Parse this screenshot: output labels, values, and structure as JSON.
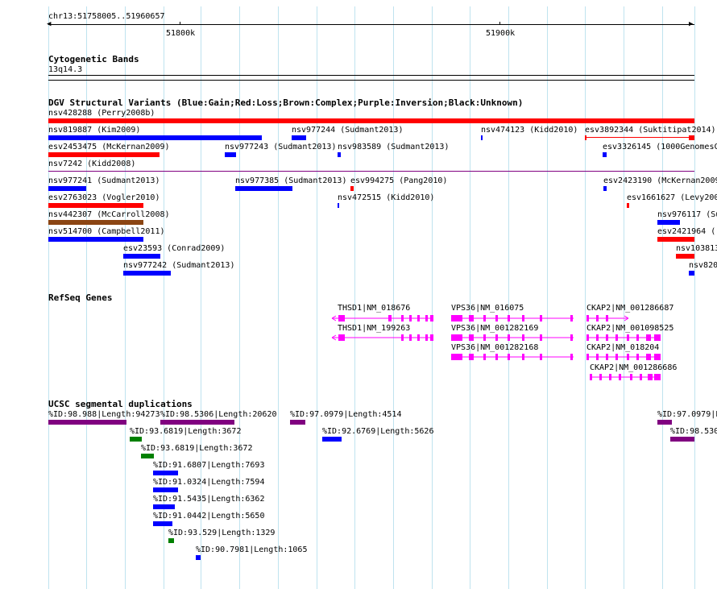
{
  "location": "chr13:51758005..51960657",
  "ruler": {
    "ticks": [
      "51800k",
      "51900k"
    ]
  },
  "colors": {
    "gain": "#0000ff",
    "loss": "#ff0000",
    "complex": "#8b4513",
    "purple": "#800080",
    "green": "#008000",
    "gene": "#ff00ff",
    "grid": "#bfe3ef"
  },
  "tracks": {
    "cytoband": {
      "title": "Cytogenetic Bands",
      "band": "13q14.3"
    },
    "dgv": {
      "title": "DGV Structural Variants (Blue:Gain;Red:Loss;Brown:Complex;Purple:Inversion;Black:Unknown)",
      "features": [
        {
          "id": "nsv428288",
          "label": "nsv428288 (Perry2008b)",
          "type": "loss"
        },
        {
          "id": "nsv819887",
          "label": "nsv819887 (Kim2009)",
          "type": "gain"
        },
        {
          "id": "nsv977244",
          "label": "nsv977244 (Sudmant2013)",
          "type": "gain"
        },
        {
          "id": "nsv474123",
          "label": "nsv474123 (Kidd2010)",
          "type": "gain"
        },
        {
          "id": "esv3892344",
          "label": "esv3892344 (Suktitipat2014)",
          "type": "loss"
        },
        {
          "id": "esv2453475",
          "label": "esv2453475 (McKernan2009)",
          "type": "loss"
        },
        {
          "id": "nsv977243",
          "label": "nsv977243 (Sudmant2013)",
          "type": "gain"
        },
        {
          "id": "nsv983589",
          "label": "nsv983589 (Sudmant2013)",
          "type": "gain"
        },
        {
          "id": "esv3326145",
          "label": "esv3326145 (1000GenomesC",
          "type": "gain"
        },
        {
          "id": "nsv7242",
          "label": "nsv7242 (Kidd2008)",
          "type": "inversion"
        },
        {
          "id": "nsv977241",
          "label": "nsv977241 (Sudmant2013)",
          "type": "gain"
        },
        {
          "id": "nsv977385",
          "label": "nsv977385 (Sudmant2013)",
          "type": "gain"
        },
        {
          "id": "esv994275",
          "label": "esv994275 (Pang2010)",
          "type": "loss"
        },
        {
          "id": "esv2423190",
          "label": "esv2423190 (McKernan2009",
          "type": "gain"
        },
        {
          "id": "esv2763023",
          "label": "esv2763023 (Vogler2010)",
          "type": "loss"
        },
        {
          "id": "nsv472515",
          "label": "nsv472515 (Kidd2010)",
          "type": "gain"
        },
        {
          "id": "esv1661627",
          "label": "esv1661627 (Levy200",
          "type": "loss"
        },
        {
          "id": "nsv442307",
          "label": "nsv442307 (McCarroll2008)",
          "type": "complex"
        },
        {
          "id": "nsv976117",
          "label": "nsv976117 (Su",
          "type": "gain"
        },
        {
          "id": "nsv514700",
          "label": "nsv514700 (Campbell2011)",
          "type": "gain"
        },
        {
          "id": "esv2421964",
          "label": "esv2421964 (",
          "type": "loss"
        },
        {
          "id": "esv23593",
          "label": "esv23593 (Conrad2009)",
          "type": "gain"
        },
        {
          "id": "nsv103813",
          "label": "nsv103813",
          "type": "loss"
        },
        {
          "id": "nsv977242",
          "label": "nsv977242 (Sudmant2013)",
          "type": "gain"
        },
        {
          "id": "nsv820",
          "label": "nsv820",
          "type": "gain"
        }
      ]
    },
    "refseq": {
      "title": "RefSeq Genes",
      "genes": [
        {
          "label": "THSD1|NM_018676",
          "strand": "-"
        },
        {
          "label": "THSD1|NM_199263",
          "strand": "-"
        },
        {
          "label": "VPS36|NM_016075",
          "strand": "-"
        },
        {
          "label": "VPS36|NM_001282169",
          "strand": "-"
        },
        {
          "label": "VPS36|NM_001282168",
          "strand": "-"
        },
        {
          "label": "CKAP2|NM_001286687",
          "strand": "+"
        },
        {
          "label": "CKAP2|NM_001098525",
          "strand": "+"
        },
        {
          "label": "CKAP2|NM_018204",
          "strand": "+"
        },
        {
          "label": "CKAP2|NM_001286686",
          "strand": "+"
        }
      ]
    },
    "segdups": {
      "title": "UCSC segmental duplications",
      "features": [
        {
          "label": "%ID:98.988|Length:94273",
          "color": "purple"
        },
        {
          "label": "%ID:98.5306|Length:20620",
          "color": "purple"
        },
        {
          "label": "%ID:97.0979|Length:4514",
          "color": "purple"
        },
        {
          "label": "%ID:97.0979|L",
          "color": "purple"
        },
        {
          "label": "%ID:93.6819|Length:3672",
          "color": "green"
        },
        {
          "label": "%ID:92.6769|Length:5626",
          "color": "gain"
        },
        {
          "label": "%ID:98.530",
          "color": "purple"
        },
        {
          "label": "%ID:93.6819|Length:3672",
          "color": "green"
        },
        {
          "label": "%ID:91.6807|Length:7693",
          "color": "gain"
        },
        {
          "label": "%ID:91.0324|Length:7594",
          "color": "gain"
        },
        {
          "label": "%ID:91.5435|Length:6362",
          "color": "gain"
        },
        {
          "label": "%ID:91.0442|Length:5650",
          "color": "gain"
        },
        {
          "label": "%ID:93.529|Length:1329",
          "color": "green"
        },
        {
          "label": "%ID:90.7981|Length:1065",
          "color": "gain"
        }
      ]
    }
  }
}
